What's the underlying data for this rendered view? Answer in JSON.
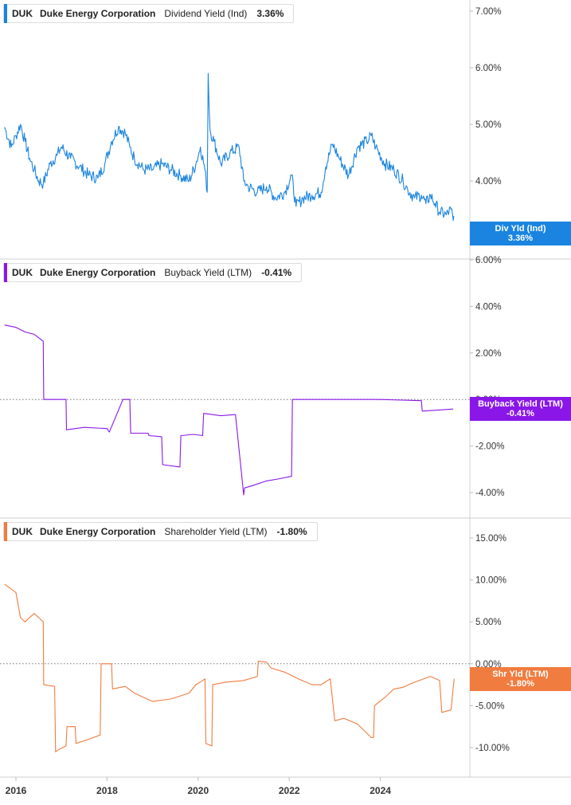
{
  "ticker": "DUK",
  "company": "Duke Energy Corporation",
  "panels": [
    {
      "id": "div",
      "metric": "Dividend Yield (Ind)",
      "value": "3.36%",
      "color": "#1a84e0",
      "badge_line1": "Div Yld (Ind)",
      "badge_line2": "3.36%"
    },
    {
      "id": "buy",
      "metric": "Buyback Yield (LTM)",
      "value": "-0.41%",
      "color": "#8a17e8",
      "badge_line1": "Buyback Yield (LTM)",
      "badge_line2": "-0.41%"
    },
    {
      "id": "shr",
      "metric": "Shareholder Yield (LTM)",
      "value": "-1.80%",
      "color": "#f07c3f",
      "badge_line1": "Shr Yld (LTM)",
      "badge_line2": "-1.80%"
    }
  ],
  "x_axis": [
    "2016",
    "2018",
    "2020",
    "2022",
    "2024"
  ],
  "chart_data": [
    {
      "type": "line",
      "name": "Dividend Yield (Ind)",
      "y_ticks": [
        "7.00%",
        "6.00%",
        "5.00%",
        "4.00%"
      ],
      "ylim": [
        3.0,
        7.2
      ],
      "x": [
        2015.75,
        2015.9,
        2016.0,
        2016.1,
        2016.2,
        2016.3,
        2016.4,
        2016.5,
        2016.6,
        2016.75,
        2016.9,
        2017.0,
        2017.2,
        2017.4,
        2017.6,
        2017.8,
        2017.95,
        2018.1,
        2018.25,
        2018.4,
        2018.5,
        2018.6,
        2018.8,
        2019.0,
        2019.2,
        2019.4,
        2019.6,
        2019.8,
        2019.95,
        2020.05,
        2020.15,
        2020.2,
        2020.22,
        2020.26,
        2020.35,
        2020.5,
        2020.7,
        2020.9,
        2021.0,
        2021.1,
        2021.3,
        2021.5,
        2021.7,
        2021.9,
        2022.05,
        2022.15,
        2022.3,
        2022.5,
        2022.7,
        2022.8,
        2022.95,
        2023.1,
        2023.3,
        2023.5,
        2023.7,
        2023.8,
        2023.9,
        2024.1,
        2024.3,
        2024.5,
        2024.6,
        2024.75,
        2024.9,
        2025.0,
        2025.1,
        2025.2,
        2025.3,
        2025.45,
        2025.55,
        2025.6,
        2025.62
      ],
      "y": [
        4.95,
        4.6,
        4.8,
        5.0,
        4.7,
        4.4,
        4.2,
        4.0,
        3.95,
        4.3,
        4.45,
        4.6,
        4.4,
        4.25,
        4.1,
        4.05,
        4.3,
        4.7,
        4.95,
        4.85,
        4.6,
        4.4,
        4.2,
        4.2,
        4.3,
        4.2,
        4.1,
        4.0,
        4.3,
        4.6,
        4.2,
        3.8,
        5.9,
        4.9,
        4.7,
        4.3,
        4.5,
        4.6,
        4.0,
        3.9,
        3.8,
        3.9,
        3.7,
        3.8,
        4.1,
        3.55,
        3.7,
        3.75,
        3.8,
        4.25,
        4.65,
        4.4,
        4.1,
        4.6,
        4.7,
        4.8,
        4.6,
        4.3,
        4.2,
        4.0,
        3.85,
        3.7,
        3.75,
        3.6,
        3.75,
        3.6,
        3.45,
        3.4,
        3.5,
        3.3,
        3.36
      ]
    },
    {
      "type": "line",
      "name": "Buyback Yield (LTM)",
      "y_ticks": [
        "6.00%",
        "4.00%",
        "2.00%",
        "0.00%",
        "-2.00%",
        "-4.00%"
      ],
      "ylim": [
        -4.6,
        6.0
      ],
      "x": [
        2015.75,
        2016.0,
        2016.2,
        2016.4,
        2016.6,
        2016.61,
        2017.1,
        2017.11,
        2017.5,
        2018.0,
        2018.05,
        2018.35,
        2018.5,
        2018.52,
        2018.9,
        2018.92,
        2019.2,
        2019.22,
        2019.6,
        2019.62,
        2019.9,
        2020.1,
        2020.12,
        2020.5,
        2020.8,
        2020.82,
        2021.0,
        2021.02,
        2021.2,
        2021.5,
        2021.8,
        2022.05,
        2022.07,
        2023.0,
        2024.0,
        2024.9,
        2024.92,
        2025.6
      ],
      "y": [
        3.2,
        3.1,
        2.9,
        2.8,
        2.5,
        0.0,
        0.0,
        -1.3,
        -1.2,
        -1.25,
        -1.4,
        0.0,
        0.0,
        -1.45,
        -1.45,
        -1.55,
        -1.6,
        -2.8,
        -2.9,
        -1.55,
        -1.5,
        -1.55,
        -0.6,
        -0.7,
        -0.65,
        -0.65,
        -4.1,
        -3.8,
        -3.7,
        -3.5,
        -3.4,
        -3.3,
        0.0,
        0.0,
        0.0,
        -0.05,
        -0.5,
        -0.41
      ]
    },
    {
      "type": "line",
      "name": "Shareholder Yield (LTM)",
      "y_ticks": [
        "15.00%",
        "10.00%",
        "5.00%",
        "0.00%",
        "-5.00%",
        "-10.00%"
      ],
      "ylim": [
        -13.0,
        15.5
      ],
      "x": [
        2015.75,
        2016.0,
        2016.1,
        2016.2,
        2016.4,
        2016.5,
        2016.6,
        2016.61,
        2016.85,
        2016.87,
        2016.95,
        2017.1,
        2017.12,
        2017.3,
        2017.32,
        2017.6,
        2017.85,
        2017.87,
        2018.1,
        2018.12,
        2018.4,
        2018.6,
        2018.8,
        2019.0,
        2019.4,
        2019.8,
        2019.95,
        2020.1,
        2020.15,
        2020.17,
        2020.3,
        2020.32,
        2020.6,
        2021.0,
        2021.3,
        2021.32,
        2021.5,
        2021.6,
        2021.9,
        2022.2,
        2022.5,
        2022.7,
        2022.9,
        2023.0,
        2023.2,
        2023.5,
        2023.8,
        2023.85,
        2023.87,
        2024.1,
        2024.3,
        2024.5,
        2024.7,
        2025.1,
        2025.3,
        2025.35,
        2025.55,
        2025.62
      ],
      "y": [
        9.5,
        8.5,
        5.5,
        5.0,
        6.0,
        5.5,
        5.0,
        -2.5,
        -2.7,
        -10.5,
        -10.2,
        -9.8,
        -7.5,
        -7.5,
        -9.5,
        -9.0,
        -8.5,
        0.0,
        0.0,
        -3.0,
        -2.7,
        -3.5,
        -4.0,
        -4.5,
        -4.2,
        -3.5,
        -2.5,
        -2.0,
        -1.8,
        -9.5,
        -9.8,
        -2.5,
        -2.2,
        -2.0,
        -1.5,
        0.3,
        0.2,
        -0.5,
        -1.0,
        -1.8,
        -2.5,
        -2.5,
        -1.8,
        -6.8,
        -6.5,
        -7.2,
        -8.8,
        -8.8,
        -5.0,
        -4.0,
        -3.0,
        -2.8,
        -2.3,
        -1.5,
        -2.0,
        -5.8,
        -5.5,
        -1.8
      ]
    }
  ]
}
